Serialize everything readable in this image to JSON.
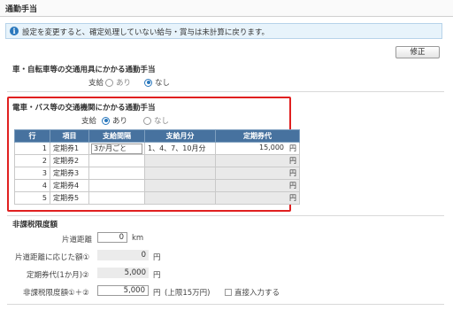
{
  "header": {
    "title": "通勤手当"
  },
  "info": {
    "text": "設定を変更すると、確定処理していない給与・賞与は未計算に戻ります。"
  },
  "toolbar": {
    "edit_label": "修正"
  },
  "vehicle": {
    "title": "車・自転車等の交通用具にかかる通勤手当",
    "pay_label": "支給",
    "options": [
      "あり",
      "なし"
    ],
    "selected": "なし"
  },
  "transit": {
    "title": "電車・バス等の交通機関にかかる通勤手当",
    "pay_label": "支給",
    "options": [
      "あり",
      "なし"
    ],
    "selected": "あり",
    "columns": [
      "行",
      "項目",
      "支給間隔",
      "支給月分",
      "定期券代"
    ],
    "yen": "円",
    "rows": [
      {
        "no": "1",
        "item": "定期券1",
        "interval": "3か月ごと",
        "months": "1、4、7、10月分",
        "amount": "15,000"
      },
      {
        "no": "2",
        "item": "定期券2",
        "interval": "",
        "months": "",
        "amount": ""
      },
      {
        "no": "3",
        "item": "定期券3",
        "interval": "",
        "months": "",
        "amount": ""
      },
      {
        "no": "4",
        "item": "定期券4",
        "interval": "",
        "months": "",
        "amount": ""
      },
      {
        "no": "5",
        "item": "定期券5",
        "interval": "",
        "months": "",
        "amount": ""
      }
    ]
  },
  "limit": {
    "title": "非課税限度額",
    "distance_label": "片道距離",
    "distance_value": "0",
    "distance_unit": "km",
    "by_distance_label": "片道距離に応じた額①",
    "by_distance_value": "0",
    "pass_label": "定期券代(1か月)②",
    "pass_value": "5,000",
    "limit_label": "非課税限度額①＋②",
    "limit_value": "5,000",
    "limit_note": "(上限15万円)",
    "direct_input_label": "直接入力する",
    "yen": "円"
  },
  "colors": {
    "accent": "#2a78bd",
    "table_header": "#47729f",
    "highlight": "#e02020"
  }
}
